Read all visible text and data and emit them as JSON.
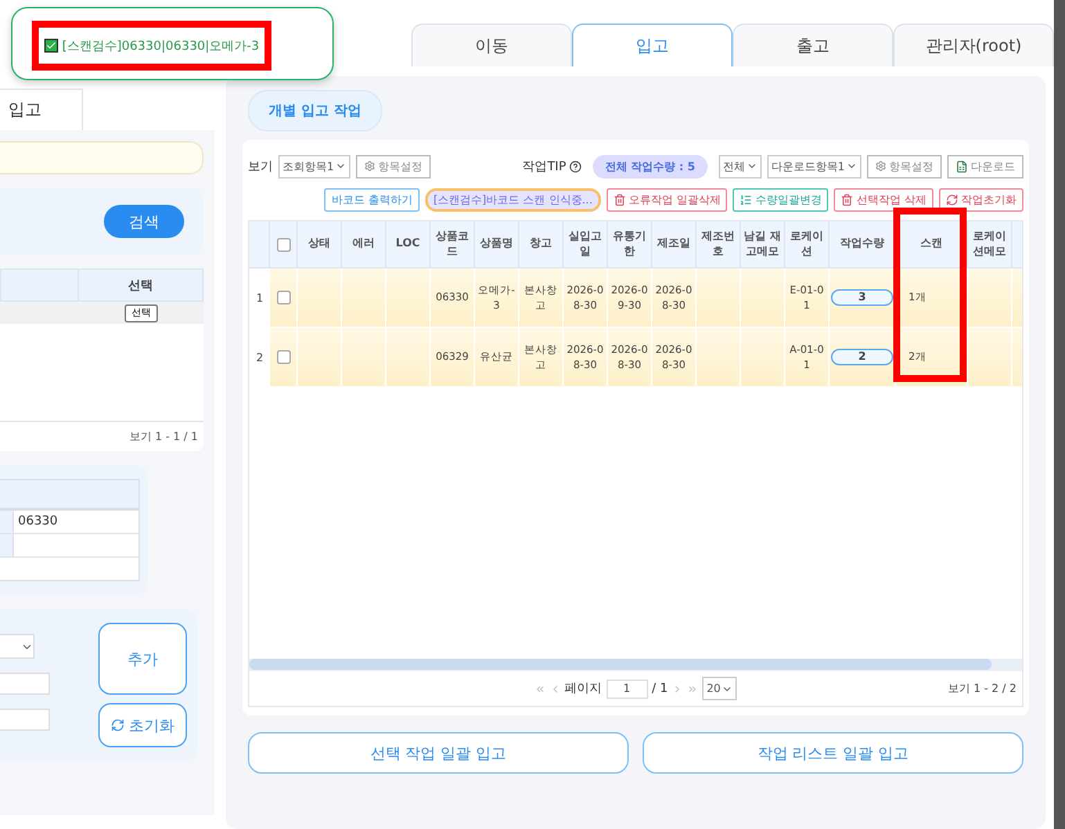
{
  "toast": {
    "text": "[스캔검수]06330|06330|오메가-3",
    "checked": true
  },
  "left": {
    "tab": "입고",
    "search_button": "검색",
    "list": {
      "column": "선택",
      "row_button": "선택",
      "footer": "보기 1 - 1 / 1"
    },
    "detail": {
      "value": "06330"
    },
    "form": {
      "add": "추가",
      "reset": "초기화"
    }
  },
  "tabs": [
    {
      "label": "이동",
      "selected": false
    },
    {
      "label": "입고",
      "selected": true
    },
    {
      "label": "출고",
      "selected": false
    },
    {
      "label": "관리자(root)",
      "selected": false
    }
  ],
  "section_title": "개별 입고 작업",
  "toolbar": {
    "view_label": "보기",
    "view_select": "조회항목1",
    "settings": "항목설정",
    "tip": "작업TIP",
    "total": "전체 작업수량 : 5",
    "filter": "전체",
    "download_select": "다운로드항목1",
    "settings_2": "항목설정",
    "download": "다운로드"
  },
  "actions": [
    {
      "label": "바코드 출력하기",
      "kind": "plain"
    },
    {
      "label": "[스캔검수]바코드 스캔 인식중...",
      "kind": "scanning"
    },
    {
      "label": "오류작업 일괄삭제",
      "kind": "delete"
    },
    {
      "label": "수량일괄변경",
      "kind": "quantity"
    },
    {
      "label": "선택작업 삭제",
      "kind": "delete"
    },
    {
      "label": "작업초기화",
      "kind": "reset"
    }
  ],
  "table": {
    "header_checked": false,
    "columns": [
      {
        "label": "상태",
        "highlighted": false
      },
      {
        "label": "에러",
        "highlighted": false
      },
      {
        "label": "LOC",
        "highlighted": false
      },
      {
        "label": "상품코드",
        "highlighted": false
      },
      {
        "label": "상품명",
        "highlighted": false
      },
      {
        "label": "창고",
        "highlighted": false
      },
      {
        "label": "실입고일",
        "highlighted": false
      },
      {
        "label": "유통기한",
        "highlighted": false
      },
      {
        "label": "제조일",
        "highlighted": false
      },
      {
        "label": "제조번호",
        "highlighted": false
      },
      {
        "label": "남길 재고메모",
        "highlighted": false
      },
      {
        "label": "로케이션",
        "highlighted": false
      },
      {
        "label": "작업수량",
        "kind": "quantity",
        "highlighted": false
      },
      {
        "label": "스캔",
        "highlighted": true
      },
      {
        "label": "로케이션메모",
        "highlighted": false
      }
    ],
    "rows": [
      {
        "no": "1",
        "checked": false,
        "cells": [
          null,
          null,
          null,
          "06330",
          "오메가-3",
          "본사창고",
          "2026-08-30",
          "2026-09-30",
          "2026-08-30",
          null,
          null,
          "E-01-01",
          "3",
          "1개",
          null
        ]
      },
      {
        "no": "2",
        "checked": false,
        "cells": [
          null,
          null,
          null,
          "06329",
          "유산균",
          "본사창고",
          "2026-08-30",
          "2026-08-30",
          "2026-08-30",
          null,
          null,
          "A-01-01",
          "2",
          "2개",
          null
        ]
      }
    ]
  },
  "pager": {
    "label": "페이지",
    "page": "1",
    "total": "/ 1",
    "size": "20",
    "summary": "보기 1 - 2 / 2"
  },
  "bottom_buttons": [
    "선택 작업 일괄 입고",
    "작업 리스트 일괄 입고"
  ]
}
